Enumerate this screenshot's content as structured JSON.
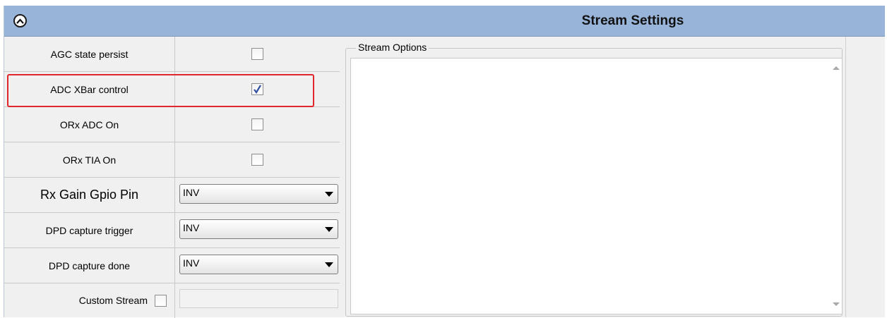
{
  "header": {
    "title": "Stream Settings",
    "collapse_icon": "chevron-up-circle-icon"
  },
  "rows": [
    {
      "label": "AGC state persist",
      "type": "checkbox",
      "checked": false
    },
    {
      "label": "ADC XBar control",
      "type": "checkbox",
      "checked": true
    },
    {
      "label": "ORx ADC On",
      "type": "checkbox",
      "checked": false
    },
    {
      "label": "ORx TIA On",
      "type": "checkbox",
      "checked": false
    },
    {
      "label": "Rx Gain Gpio Pin",
      "type": "select",
      "value": "INV"
    },
    {
      "label": "DPD capture trigger",
      "type": "select",
      "value": "INV"
    },
    {
      "label": "DPD capture done",
      "type": "select",
      "value": "INV"
    }
  ],
  "custom_stream": {
    "label": "Custom Stream",
    "checked": false,
    "value": ""
  },
  "stream_options": {
    "title": "Stream Options",
    "content": ""
  },
  "colors": {
    "header_bg": "#98b4d8",
    "highlight": "#e0262b",
    "check_mark": "#2d4f9e"
  }
}
